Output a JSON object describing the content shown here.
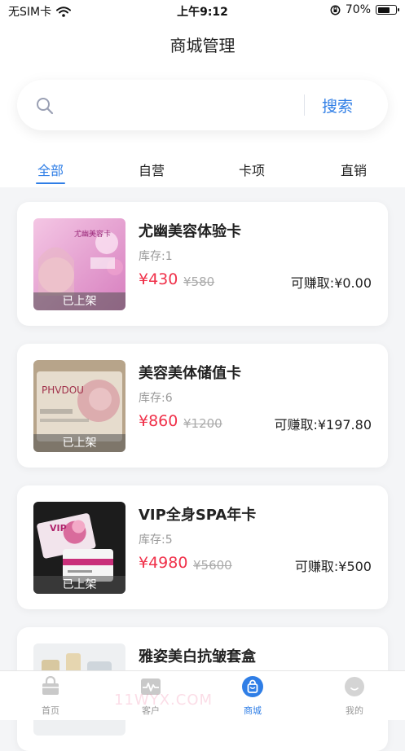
{
  "status_bar": {
    "carrier": "无SIM卡",
    "time": "上午9:12",
    "battery_percent": "70%",
    "battery_level": 0.7
  },
  "header": {
    "title": "商城管理"
  },
  "search": {
    "placeholder": "",
    "button_label": "搜索"
  },
  "tabs": [
    {
      "label": "全部",
      "active": true
    },
    {
      "label": "自营",
      "active": false
    },
    {
      "label": "卡项",
      "active": false
    },
    {
      "label": "直销",
      "active": false
    }
  ],
  "products": [
    {
      "name": "尤幽美容体验卡",
      "stock": "库存:1",
      "price": "¥430",
      "original_price": "¥580",
      "earn": "可赚取:¥0.00",
      "status": "已上架",
      "thumb_text": "尤幽美容卡",
      "theme": "pink"
    },
    {
      "name": "美容美体储值卡",
      "stock": "库存:6",
      "price": "¥860",
      "original_price": "¥1200",
      "earn": "可赚取:¥197.80",
      "status": "已上架",
      "thumb_text": "PHVDOU",
      "theme": "tan"
    },
    {
      "name": "VIP全身SPA年卡",
      "stock": "库存:5",
      "price": "¥4980",
      "original_price": "¥5600",
      "earn": "可赚取:¥500",
      "status": "已上架",
      "thumb_text": "VIP",
      "theme": "dark"
    },
    {
      "name": "雅姿美白抗皱套盒",
      "stock": "",
      "price": "",
      "original_price": "",
      "earn": "",
      "status": "",
      "thumb_text": "",
      "theme": "light"
    }
  ],
  "tabbar": [
    {
      "label": "首页",
      "icon": "store-icon",
      "active": false
    },
    {
      "label": "客户",
      "icon": "pulse-icon",
      "active": false
    },
    {
      "label": "商城",
      "icon": "shopping-bag-icon",
      "active": true
    },
    {
      "label": "我的",
      "icon": "face-icon",
      "active": false
    }
  ],
  "watermark": "11WYX.COM",
  "colors": {
    "accent": "#2f7ee6",
    "price": "#f0314a",
    "background": "#f4f5f7"
  }
}
